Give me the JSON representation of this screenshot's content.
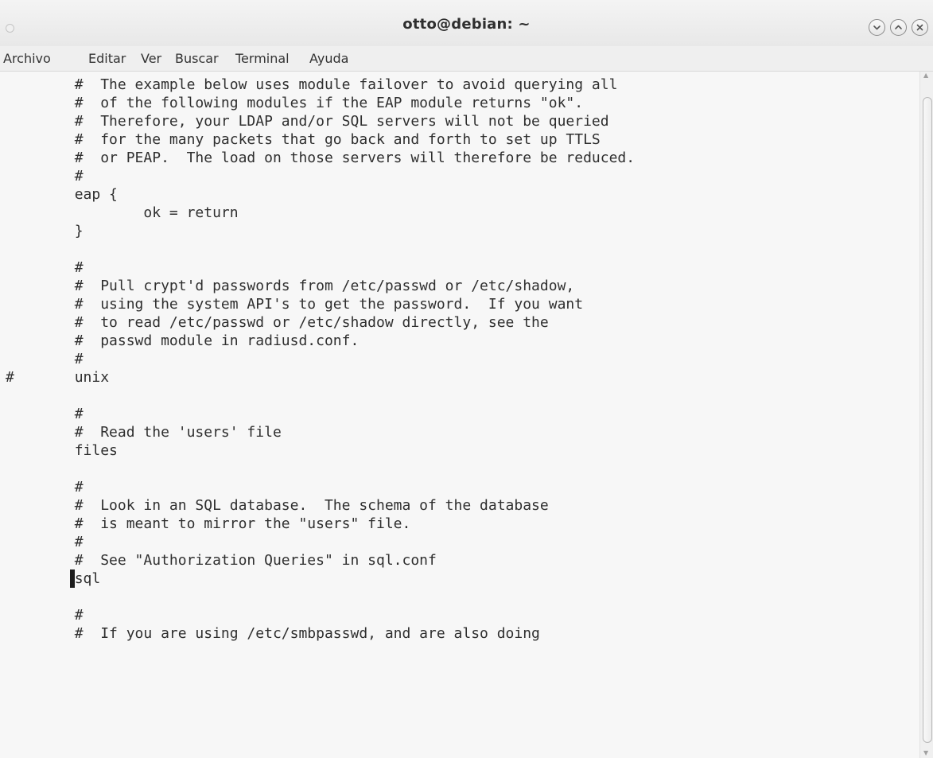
{
  "window": {
    "title": "otto@debian: ~"
  },
  "menu": {
    "items": [
      "Archivo",
      "Editar",
      "Ver",
      "Buscar",
      "Terminal",
      "Ayuda"
    ]
  },
  "terminal": {
    "lines": [
      "        #  The example below uses module failover to avoid querying all",
      "        #  of the following modules if the EAP module returns \"ok\".",
      "        #  Therefore, your LDAP and/or SQL servers will not be queried",
      "        #  for the many packets that go back and forth to set up TTLS",
      "        #  or PEAP.  The load on those servers will therefore be reduced.",
      "        #",
      "        eap {",
      "                ok = return",
      "        }",
      "",
      "        #",
      "        #  Pull crypt'd passwords from /etc/passwd or /etc/shadow,",
      "        #  using the system API's to get the password.  If you want",
      "        #  to read /etc/passwd or /etc/shadow directly, see the",
      "        #  passwd module in radiusd.conf.",
      "        #",
      "#       unix",
      "",
      "        #",
      "        #  Read the 'users' file",
      "        files",
      "",
      "        #",
      "        #  Look in an SQL database.  The schema of the database",
      "        #  is meant to mirror the \"users\" file.",
      "        #",
      "        #  See \"Authorization Queries\" in sql.conf",
      "        sql",
      "",
      "        #",
      "        #  If you are using /etc/smbpasswd, and are also doing"
    ]
  },
  "icons": {
    "minimize": "chevron-down-icon",
    "maximize": "chevron-up-icon",
    "close": "close-icon"
  }
}
